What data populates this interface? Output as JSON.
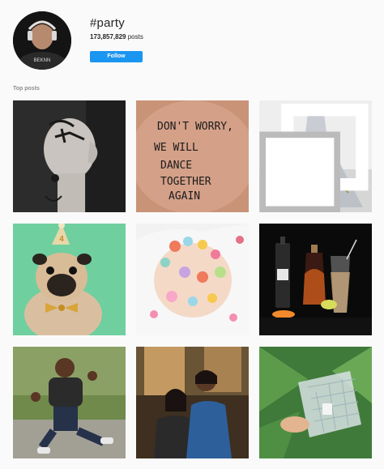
{
  "header": {
    "hashtag": "#party",
    "post_count": "173,857,829",
    "post_count_suffix": " posts",
    "follow_label": "Follow"
  },
  "avatar": {
    "text": "BEKNN"
  },
  "sections": {
    "top_posts_label": "Top posts"
  },
  "posts": [
    {
      "name": "shaved-head-tattoo"
    },
    {
      "name": "dont-worry-hand",
      "text_lines": [
        "DON'T WORRY,",
        "WE WILL",
        "DANCE",
        "TOGETHER",
        "AGAIN"
      ]
    },
    {
      "name": "wedding-dress",
      "icon": "multiple-photos-icon"
    },
    {
      "name": "pug-party-hat",
      "badge": "4"
    },
    {
      "name": "candy-spread"
    },
    {
      "name": "cocktail-bottles"
    },
    {
      "name": "kid-waving"
    },
    {
      "name": "couple-portrait"
    },
    {
      "name": "glass-gift"
    }
  ],
  "colors": {
    "accent": "#1a95f0",
    "text": "#262626",
    "muted": "#8e8e8e",
    "background": "#fafafa"
  }
}
